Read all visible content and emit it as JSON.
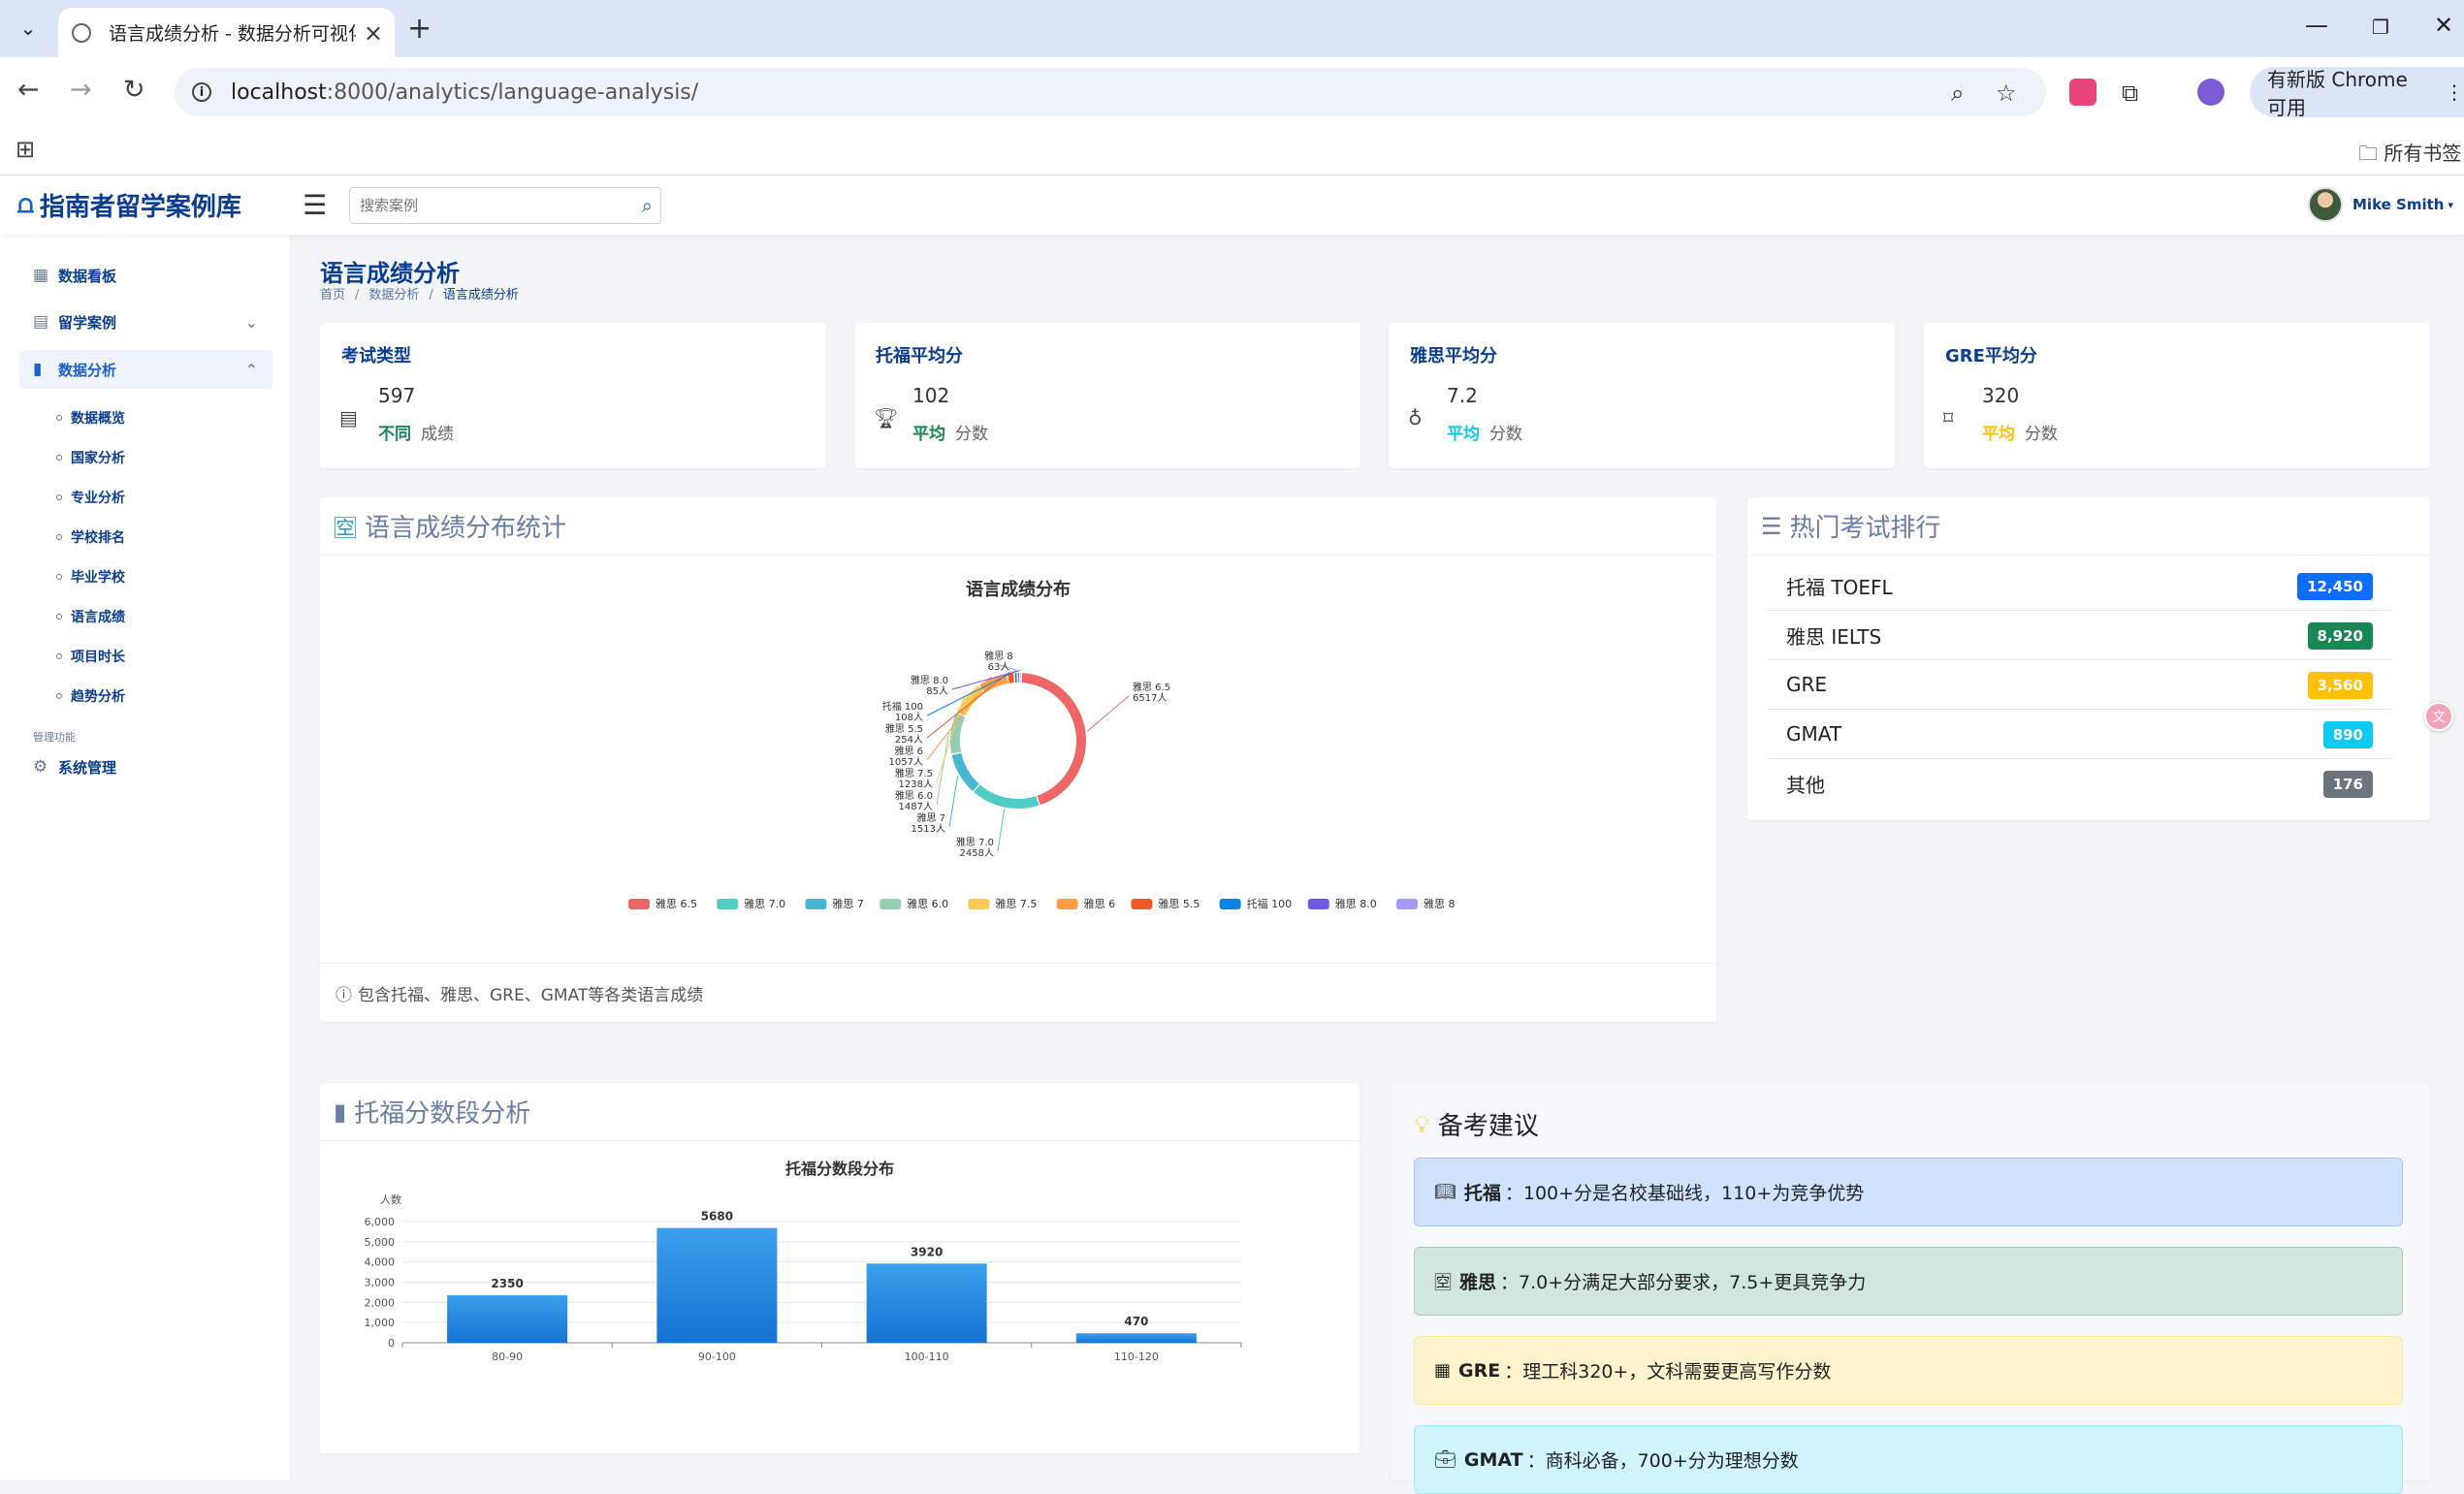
{
  "browser": {
    "tab_title": "语言成绩分析 - 数据分析可视化",
    "url_host": "localhost",
    "url_path": ":8000/analytics/language-analysis/",
    "update_label": "有新版 Chrome 可用",
    "bookmarks_label": "所有书签"
  },
  "topnav": {
    "brand": "指南者留学案例库",
    "search_placeholder": "搜索案例",
    "user_name": "Mike Smith"
  },
  "sidebar": {
    "items": [
      {
        "label": "数据看板",
        "icon": "grid-icon"
      },
      {
        "label": "留学案例",
        "icon": "document-icon"
      },
      {
        "label": "数据分析",
        "icon": "bar-chart-icon"
      }
    ],
    "subitems": [
      "数据概览",
      "国家分析",
      "专业分析",
      "学校排名",
      "毕业学校",
      "语言成绩",
      "项目时长",
      "趋势分析"
    ],
    "section_label": "管理功能",
    "admin_item": "系统管理"
  },
  "page": {
    "title": "语言成绩分析",
    "breadcrumbs": [
      "首页",
      "数据分析",
      "语言成绩分析"
    ]
  },
  "stats": [
    {
      "title": "考试类型",
      "value": "597",
      "highlight": "不同",
      "suffix": "成绩",
      "color": "#198754",
      "icon": "document-icon"
    },
    {
      "title": "托福平均分",
      "value": "102",
      "highlight": "平均",
      "suffix": "分数",
      "color": "#198754",
      "icon": "trophy-icon"
    },
    {
      "title": "雅思平均分",
      "value": "7.2",
      "highlight": "平均",
      "suffix": "分数",
      "color": "#0dcaf0",
      "icon": "award-icon"
    },
    {
      "title": "GRE平均分",
      "value": "320",
      "highlight": "平均",
      "suffix": "分数",
      "color": "#ffc107",
      "icon": "bookmark-icon"
    }
  ],
  "distribution_card": {
    "header": "语言成绩分布统计",
    "footer": "包含托福、雅思、GRE、GMAT等各类语言成绩"
  },
  "ranking_card": {
    "header": "热门考试排行",
    "rows": [
      {
        "name": "托福 TOEFL",
        "count": "12,450",
        "color": "#0d6efd"
      },
      {
        "name": "雅思 IELTS",
        "count": "8,920",
        "color": "#198754"
      },
      {
        "name": "GRE",
        "count": "3,560",
        "color": "#ffc107"
      },
      {
        "name": "GMAT",
        "count": "890",
        "color": "#0dcaf0"
      },
      {
        "name": "其他",
        "count": "176",
        "color": "#6c757d"
      }
    ]
  },
  "toefl_card": {
    "header": "托福分数段分析"
  },
  "advice_card": {
    "header": "备考建议",
    "tips": [
      {
        "name": "托福",
        "text": "：100+分是名校基础线，110+为竞争优势",
        "bg": "#cfe2ff",
        "border": "#9ec5fe",
        "icon": "book-icon"
      },
      {
        "name": "雅思",
        "text": "：7.0+分满足大部分要求，7.5+更具竞争力",
        "bg": "#d1e7dd",
        "border": "#a3cfbb",
        "icon": "translate-icon"
      },
      {
        "name": "GRE",
        "text": "：理工科320+，文科需要更高写作分数",
        "bg": "#fff3cd",
        "border": "#ffe69c",
        "icon": "calculator-icon"
      },
      {
        "name": "GMAT",
        "text": "：商科必备，700+分为理想分数",
        "bg": "#cff4fc",
        "border": "#9eeaf9",
        "icon": "briefcase-icon"
      }
    ]
  },
  "chart_data": [
    {
      "type": "pie",
      "title": "语言成绩分布",
      "unit": "人",
      "slices": [
        {
          "name": "雅思 6.5",
          "value": 6517,
          "color": "#ee6666"
        },
        {
          "name": "雅思 7.0",
          "value": 2458,
          "color": "#4ecdc4"
        },
        {
          "name": "雅思 7",
          "value": 1513,
          "color": "#45b7d1"
        },
        {
          "name": "雅思 6.0",
          "value": 1487,
          "color": "#96ceb4"
        },
        {
          "name": "雅思 7.5",
          "value": 1238,
          "color": "#feca57"
        },
        {
          "name": "雅思 6",
          "value": 1057,
          "color": "#ff9f43"
        },
        {
          "name": "雅思 5.5",
          "value": 254,
          "color": "#ee5a24"
        },
        {
          "name": "托福 100",
          "value": 108,
          "color": "#0984e3"
        },
        {
          "name": "雅思 8.0",
          "value": 85,
          "color": "#6c5ce7"
        },
        {
          "name": "雅思 8",
          "value": 63,
          "color": "#a29bfe"
        }
      ]
    },
    {
      "type": "bar",
      "title": "托福分数段分布",
      "ylabel": "人数",
      "categories": [
        "80-90",
        "90-100",
        "100-110",
        "110-120"
      ],
      "values": [
        2350,
        5680,
        3920,
        470
      ],
      "ylim": [
        0,
        6000
      ],
      "yticks": [
        0,
        1000,
        2000,
        3000,
        4000,
        5000,
        6000
      ],
      "ytick_labels": [
        "0",
        "1,000",
        "2,000",
        "3,000",
        "4,000",
        "5,000",
        "6,000"
      ]
    }
  ]
}
